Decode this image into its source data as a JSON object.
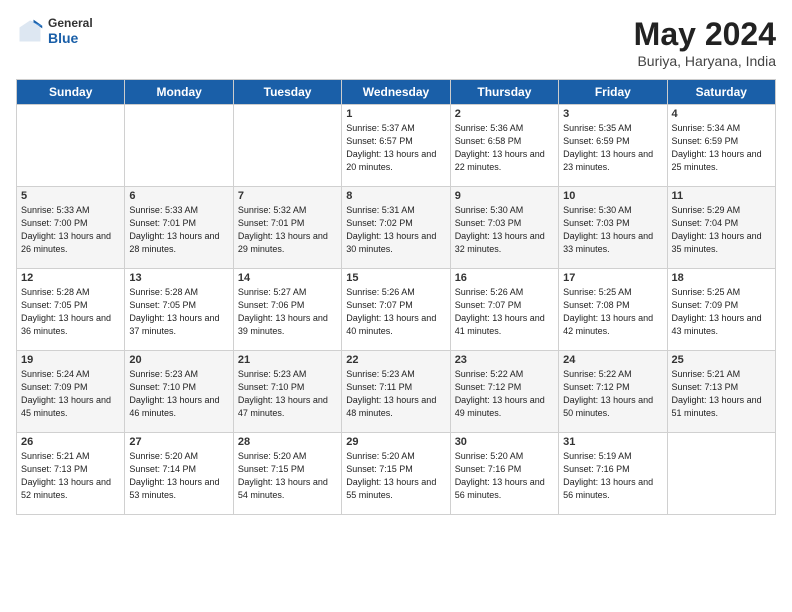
{
  "header": {
    "logo_general": "General",
    "logo_blue": "Blue",
    "title": "May 2024",
    "subtitle": "Buriya, Haryana, India"
  },
  "days_of_week": [
    "Sunday",
    "Monday",
    "Tuesday",
    "Wednesday",
    "Thursday",
    "Friday",
    "Saturday"
  ],
  "weeks": [
    [
      {
        "day": "",
        "sunrise": "",
        "sunset": "",
        "daylight": ""
      },
      {
        "day": "",
        "sunrise": "",
        "sunset": "",
        "daylight": ""
      },
      {
        "day": "",
        "sunrise": "",
        "sunset": "",
        "daylight": ""
      },
      {
        "day": "1",
        "sunrise": "Sunrise: 5:37 AM",
        "sunset": "Sunset: 6:57 PM",
        "daylight": "Daylight: 13 hours and 20 minutes."
      },
      {
        "day": "2",
        "sunrise": "Sunrise: 5:36 AM",
        "sunset": "Sunset: 6:58 PM",
        "daylight": "Daylight: 13 hours and 22 minutes."
      },
      {
        "day": "3",
        "sunrise": "Sunrise: 5:35 AM",
        "sunset": "Sunset: 6:59 PM",
        "daylight": "Daylight: 13 hours and 23 minutes."
      },
      {
        "day": "4",
        "sunrise": "Sunrise: 5:34 AM",
        "sunset": "Sunset: 6:59 PM",
        "daylight": "Daylight: 13 hours and 25 minutes."
      }
    ],
    [
      {
        "day": "5",
        "sunrise": "Sunrise: 5:33 AM",
        "sunset": "Sunset: 7:00 PM",
        "daylight": "Daylight: 13 hours and 26 minutes."
      },
      {
        "day": "6",
        "sunrise": "Sunrise: 5:33 AM",
        "sunset": "Sunset: 7:01 PM",
        "daylight": "Daylight: 13 hours and 28 minutes."
      },
      {
        "day": "7",
        "sunrise": "Sunrise: 5:32 AM",
        "sunset": "Sunset: 7:01 PM",
        "daylight": "Daylight: 13 hours and 29 minutes."
      },
      {
        "day": "8",
        "sunrise": "Sunrise: 5:31 AM",
        "sunset": "Sunset: 7:02 PM",
        "daylight": "Daylight: 13 hours and 30 minutes."
      },
      {
        "day": "9",
        "sunrise": "Sunrise: 5:30 AM",
        "sunset": "Sunset: 7:03 PM",
        "daylight": "Daylight: 13 hours and 32 minutes."
      },
      {
        "day": "10",
        "sunrise": "Sunrise: 5:30 AM",
        "sunset": "Sunset: 7:03 PM",
        "daylight": "Daylight: 13 hours and 33 minutes."
      },
      {
        "day": "11",
        "sunrise": "Sunrise: 5:29 AM",
        "sunset": "Sunset: 7:04 PM",
        "daylight": "Daylight: 13 hours and 35 minutes."
      }
    ],
    [
      {
        "day": "12",
        "sunrise": "Sunrise: 5:28 AM",
        "sunset": "Sunset: 7:05 PM",
        "daylight": "Daylight: 13 hours and 36 minutes."
      },
      {
        "day": "13",
        "sunrise": "Sunrise: 5:28 AM",
        "sunset": "Sunset: 7:05 PM",
        "daylight": "Daylight: 13 hours and 37 minutes."
      },
      {
        "day": "14",
        "sunrise": "Sunrise: 5:27 AM",
        "sunset": "Sunset: 7:06 PM",
        "daylight": "Daylight: 13 hours and 39 minutes."
      },
      {
        "day": "15",
        "sunrise": "Sunrise: 5:26 AM",
        "sunset": "Sunset: 7:07 PM",
        "daylight": "Daylight: 13 hours and 40 minutes."
      },
      {
        "day": "16",
        "sunrise": "Sunrise: 5:26 AM",
        "sunset": "Sunset: 7:07 PM",
        "daylight": "Daylight: 13 hours and 41 minutes."
      },
      {
        "day": "17",
        "sunrise": "Sunrise: 5:25 AM",
        "sunset": "Sunset: 7:08 PM",
        "daylight": "Daylight: 13 hours and 42 minutes."
      },
      {
        "day": "18",
        "sunrise": "Sunrise: 5:25 AM",
        "sunset": "Sunset: 7:09 PM",
        "daylight": "Daylight: 13 hours and 43 minutes."
      }
    ],
    [
      {
        "day": "19",
        "sunrise": "Sunrise: 5:24 AM",
        "sunset": "Sunset: 7:09 PM",
        "daylight": "Daylight: 13 hours and 45 minutes."
      },
      {
        "day": "20",
        "sunrise": "Sunrise: 5:23 AM",
        "sunset": "Sunset: 7:10 PM",
        "daylight": "Daylight: 13 hours and 46 minutes."
      },
      {
        "day": "21",
        "sunrise": "Sunrise: 5:23 AM",
        "sunset": "Sunset: 7:10 PM",
        "daylight": "Daylight: 13 hours and 47 minutes."
      },
      {
        "day": "22",
        "sunrise": "Sunrise: 5:23 AM",
        "sunset": "Sunset: 7:11 PM",
        "daylight": "Daylight: 13 hours and 48 minutes."
      },
      {
        "day": "23",
        "sunrise": "Sunrise: 5:22 AM",
        "sunset": "Sunset: 7:12 PM",
        "daylight": "Daylight: 13 hours and 49 minutes."
      },
      {
        "day": "24",
        "sunrise": "Sunrise: 5:22 AM",
        "sunset": "Sunset: 7:12 PM",
        "daylight": "Daylight: 13 hours and 50 minutes."
      },
      {
        "day": "25",
        "sunrise": "Sunrise: 5:21 AM",
        "sunset": "Sunset: 7:13 PM",
        "daylight": "Daylight: 13 hours and 51 minutes."
      }
    ],
    [
      {
        "day": "26",
        "sunrise": "Sunrise: 5:21 AM",
        "sunset": "Sunset: 7:13 PM",
        "daylight": "Daylight: 13 hours and 52 minutes."
      },
      {
        "day": "27",
        "sunrise": "Sunrise: 5:20 AM",
        "sunset": "Sunset: 7:14 PM",
        "daylight": "Daylight: 13 hours and 53 minutes."
      },
      {
        "day": "28",
        "sunrise": "Sunrise: 5:20 AM",
        "sunset": "Sunset: 7:15 PM",
        "daylight": "Daylight: 13 hours and 54 minutes."
      },
      {
        "day": "29",
        "sunrise": "Sunrise: 5:20 AM",
        "sunset": "Sunset: 7:15 PM",
        "daylight": "Daylight: 13 hours and 55 minutes."
      },
      {
        "day": "30",
        "sunrise": "Sunrise: 5:20 AM",
        "sunset": "Sunset: 7:16 PM",
        "daylight": "Daylight: 13 hours and 56 minutes."
      },
      {
        "day": "31",
        "sunrise": "Sunrise: 5:19 AM",
        "sunset": "Sunset: 7:16 PM",
        "daylight": "Daylight: 13 hours and 56 minutes."
      },
      {
        "day": "",
        "sunrise": "",
        "sunset": "",
        "daylight": ""
      }
    ]
  ]
}
